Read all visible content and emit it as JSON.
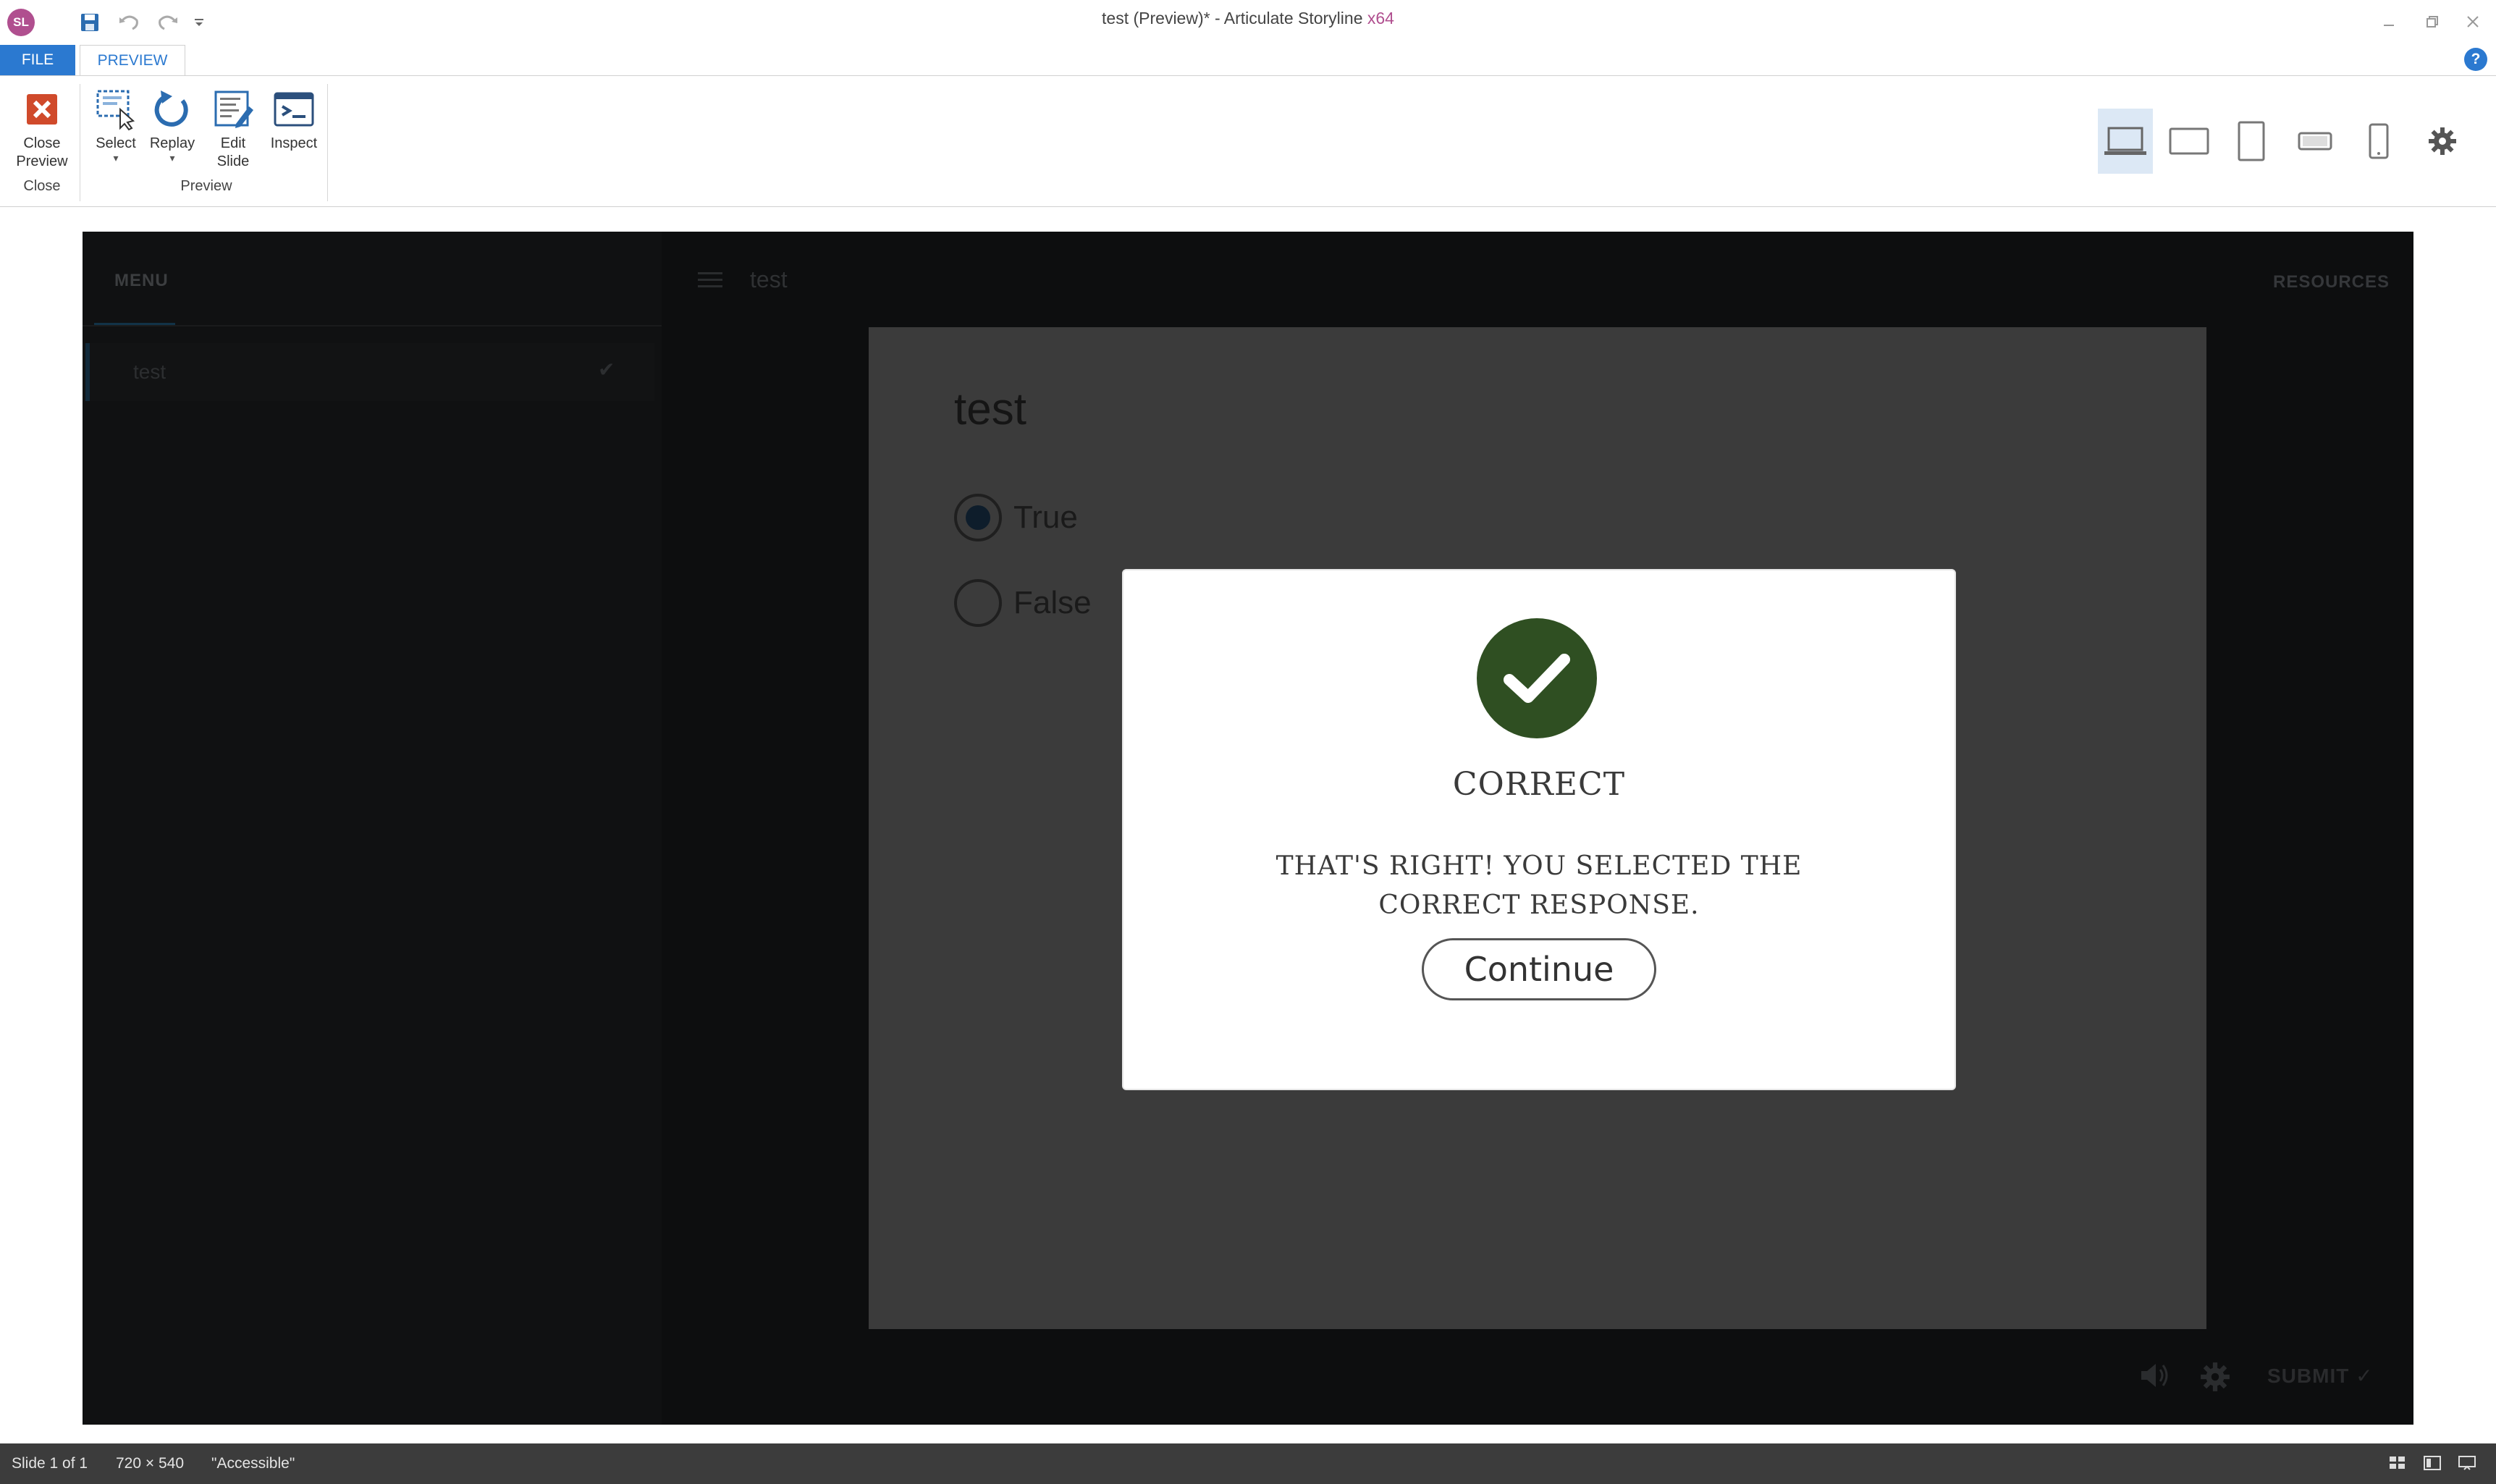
{
  "app": {
    "logo_text": "SL",
    "window_title": "test (Preview)* -  Articulate Storyline ",
    "window_title_suffix": "x64"
  },
  "ribbon": {
    "tabs": {
      "file": "FILE",
      "preview": "PREVIEW"
    },
    "buttons": {
      "close_preview": "Close\nPreview",
      "select": "Select",
      "replay": "Replay",
      "edit_slide": "Edit\nSlide",
      "inspect": "Inspect"
    },
    "groups": {
      "close": "Close",
      "preview": "Preview"
    },
    "devices": [
      "laptop-icon",
      "tablet-landscape-icon",
      "tablet-portrait-icon",
      "phone-landscape-icon",
      "phone-portrait-icon",
      "gear-icon"
    ]
  },
  "player": {
    "menu_title": "MENU",
    "menu_items": [
      {
        "label": "test",
        "completed": true
      }
    ],
    "slide_tab_title": "test",
    "resources": "RESOURCES",
    "submit": "SUBMIT"
  },
  "slide": {
    "heading": "test",
    "choices": [
      {
        "label": "True",
        "selected": true
      },
      {
        "label": "False",
        "selected": false
      }
    ]
  },
  "feedback": {
    "title": "CORRECT",
    "message": "THAT'S RIGHT!  YOU SELECTED THE CORRECT RESPONSE.",
    "continue": "Continue",
    "icon_color": "#2f4f22"
  },
  "status": {
    "slide": "Slide 1 of 1",
    "size": "720 × 540",
    "theme": "\"Accessible\""
  },
  "colors": {
    "accent": "#2b79d0",
    "close_red": "#d04a2b",
    "brand": "#b04f8f"
  }
}
